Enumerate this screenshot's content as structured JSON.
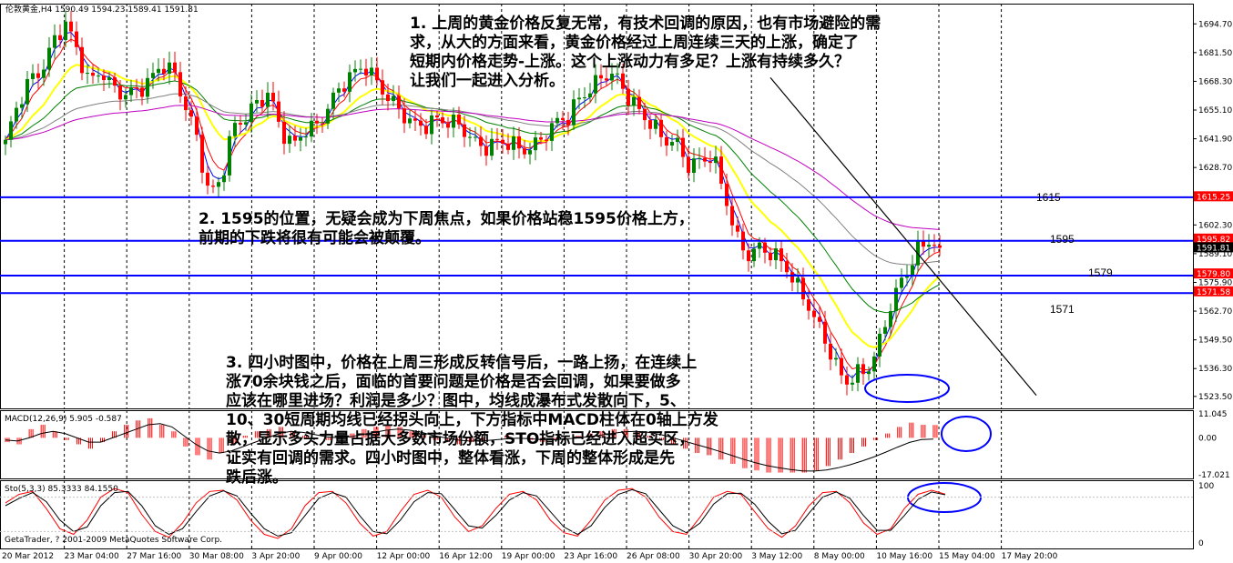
{
  "chart_data": [
    {
      "type": "candlestick",
      "header": "伦敦黄金,H4  1590.49 1594.23 1589.41 1591.81",
      "ylim": [
        1518,
        1704
      ],
      "y_ticks": [
        "1694.70",
        "1681.50",
        "1668.30",
        "1655.10",
        "1641.90",
        "1628.70",
        "1615.50",
        "1602.30",
        "1589.10",
        "1575.90",
        "1562.70",
        "1549.50",
        "1536.30",
        "1523.50"
      ],
      "x_ticks": [
        "20 Mar 2012",
        "23 Mar 04:00",
        "27 Mar 16:00",
        "30 Mar 08:00",
        "3 Apr 20:00",
        "9 Apr 00:00",
        "12 Apr 00:00",
        "16 Apr 12:00",
        "19 Apr 00:00",
        "23 Apr 16:00",
        "26 Apr 08:00",
        "30 Apr 20:00",
        "3 May 12:00",
        "8 May 00:00",
        "10 May 16:00",
        "15 May 04:00",
        "17 May 20:00"
      ],
      "candle_count": 172,
      "close_path": [
        1640,
        1655,
        1668,
        1675,
        1688,
        1694,
        1680,
        1668,
        1676,
        1665,
        1660,
        1663,
        1670,
        1678,
        1672,
        1655,
        1642,
        1618,
        1624,
        1645,
        1650,
        1660,
        1665,
        1645,
        1636,
        1646,
        1650,
        1658,
        1664,
        1670,
        1677,
        1670,
        1660,
        1652,
        1648,
        1650,
        1652,
        1648,
        1646,
        1642,
        1640,
        1640,
        1638,
        1636,
        1640,
        1645,
        1648,
        1650,
        1662,
        1668,
        1672,
        1668,
        1660,
        1656,
        1650,
        1640,
        1638,
        1630,
        1634,
        1635,
        1615,
        1595,
        1590,
        1594,
        1588,
        1582,
        1575,
        1568,
        1555,
        1540,
        1528,
        1535,
        1538,
        1548,
        1565,
        1578,
        1592,
        1596,
        1591.81
      ],
      "price_labels": [
        {
          "text": "1615.25",
          "value": 1615.25,
          "color": "#ff0000"
        },
        {
          "text": "1595.82",
          "value": 1595.82,
          "color": "#ff0000"
        },
        {
          "text": "1591.81",
          "value": 1591.81,
          "color": "#000000"
        },
        {
          "text": "1579.80",
          "value": 1579.8,
          "color": "#ff0000"
        },
        {
          "text": "1571.58",
          "value": 1571.58,
          "color": "#ff0000"
        }
      ],
      "levels": [
        {
          "value": 1615,
          "label": "1615"
        },
        {
          "value": 1595,
          "label": "1595"
        },
        {
          "value": 1579,
          "label": "1579"
        },
        {
          "value": 1571,
          "label": "1571"
        }
      ],
      "moving_averages": [
        {
          "color": "#0000ff",
          "period": 5
        },
        {
          "color": "#ff0000",
          "period": 10
        },
        {
          "color": "#ffff00",
          "period": 30
        },
        {
          "color": "#008000",
          "period": 60
        },
        {
          "color": "#808080",
          "period": 120
        },
        {
          "color": "#c000c0",
          "period": 200
        }
      ],
      "trendline": {
        "from": {
          "candle": 140,
          "price": 1670
        },
        "to": {
          "candle": 167,
          "price": 1524
        }
      }
    },
    {
      "type": "histogram",
      "header": "MACD(12,26,9) 5.905 -0.587",
      "ylim": [
        -17.021,
        11.045
      ],
      "y_ticks": [
        "11.045",
        "0.00",
        "-17.021"
      ],
      "values": [
        -2,
        -3,
        4,
        6,
        3,
        -1,
        -3,
        -5,
        -2,
        3,
        6,
        8,
        9,
        6,
        3,
        -4,
        -8,
        -10,
        -7,
        -3,
        1,
        3,
        4,
        5,
        3,
        1,
        0,
        -1,
        0,
        2,
        4,
        5,
        6,
        5,
        3,
        1,
        -1,
        -2,
        -3,
        -2,
        -1,
        0,
        1,
        0,
        -1,
        -2,
        -1,
        0,
        1,
        2,
        3,
        4,
        4,
        3,
        1,
        -1,
        -3,
        -5,
        -7,
        -8,
        -10,
        -12,
        -14,
        -15,
        -16,
        -16,
        -16,
        -16,
        -15,
        -13,
        -10,
        -7,
        -4,
        -1,
        2,
        5,
        7,
        6,
        5.905
      ],
      "signal": [
        -1,
        -1.5,
        0,
        2,
        3,
        2,
        0,
        -2,
        -2,
        0,
        2,
        4,
        6,
        6.5,
        5,
        1,
        -3,
        -6,
        -7,
        -6,
        -4,
        -2,
        0,
        2,
        3,
        2.5,
        1.5,
        0.5,
        0,
        0.5,
        1.5,
        2.5,
        3.5,
        4,
        3.5,
        2.5,
        1,
        0,
        -1,
        -1.5,
        -1.5,
        -1,
        -0.5,
        -0.2,
        -0.4,
        -0.8,
        -0.9,
        -0.6,
        -0.1,
        0.5,
        1.2,
        2,
        2.8,
        3,
        2.6,
        1.6,
        0.2,
        -1.4,
        -3,
        -4.5,
        -6.2,
        -8,
        -9.8,
        -11.4,
        -12.8,
        -13.8,
        -14.6,
        -15.2,
        -15.3,
        -14.8,
        -13.8,
        -12.4,
        -10.7,
        -8.8,
        -6.6,
        -4.3,
        -2.1,
        -0.8,
        -0.587
      ],
      "hist_color": "#ff0000",
      "signal_color": "#000000"
    },
    {
      "type": "line",
      "header": "Sto(5,3,3) 85.3333 84.1550",
      "ylim": [
        0,
        100
      ],
      "y_ticks": [
        "100",
        "0"
      ],
      "series": [
        {
          "color": "#ff0000",
          "values": [
            70,
            85,
            90,
            60,
            25,
            15,
            40,
            80,
            95,
            88,
            50,
            20,
            10,
            35,
            70,
            90,
            92,
            75,
            40,
            15,
            8,
            25,
            65,
            88,
            90,
            70,
            35,
            12,
            20,
            55,
            85,
            92,
            80,
            45,
            20,
            30,
            60,
            85,
            90,
            75,
            40,
            18,
            12,
            40,
            75,
            92,
            95,
            80,
            45,
            20,
            15,
            45,
            80,
            90,
            85,
            55,
            25,
            10,
            30,
            65,
            88,
            90,
            70,
            35,
            15,
            25,
            60,
            85,
            92,
            85.3333
          ]
        },
        {
          "color": "#000000",
          "values": [
            65,
            78,
            88,
            72,
            40,
            20,
            28,
            65,
            88,
            90,
            65,
            30,
            15,
            25,
            55,
            82,
            91,
            82,
            52,
            25,
            12,
            18,
            48,
            78,
            88,
            80,
            48,
            20,
            16,
            40,
            72,
            88,
            86,
            58,
            30,
            26,
            48,
            75,
            88,
            82,
            55,
            28,
            15,
            30,
            62,
            85,
            93,
            86,
            58,
            30,
            18,
            35,
            68,
            86,
            87,
            68,
            38,
            16,
            22,
            52,
            80,
            89,
            78,
            48,
            22,
            22,
            48,
            76,
            89,
            84.155
          ]
        }
      ]
    }
  ],
  "annotations": {
    "a1": "1. 上周的黄金价格反复无常，有技术回调的原因，也有市场避险的需\n求，从大的方面来看，黄金价格经过上周连续三天的上涨，确定了\n短期内价格走势-上涨。这个上涨动力有多足？上涨有持续多久？\n让我们一起进入分析。",
    "a2": "2. 1595的位置，无疑会成为下周焦点，如果价格站稳1595价格上方，\n前期的下跌将很有可能会被颠覆。",
    "a3": "3. 四小时图中，价格在上周三形成反转信号后，一路上扬，在连续上\n涨70余块钱之后，面临的首要问题是价格是否会回调，如果要做多\n应该在哪里进场？利润是多少？图中，均线成瀑布式发散向下，5、\n10、30短周期均线已经拐头向上，下方指标中MACD柱体在0轴上方发\n散，显示多头力量占据大多数市场份额，STO指标已经进入超买区，\n证实有回调的需求。四小时图中，整体看涨，下周的整体形成是先\n跌后涨。"
  },
  "footer": "GetaTrader, ? 2001-2009 MetaQuotes Software Corp."
}
